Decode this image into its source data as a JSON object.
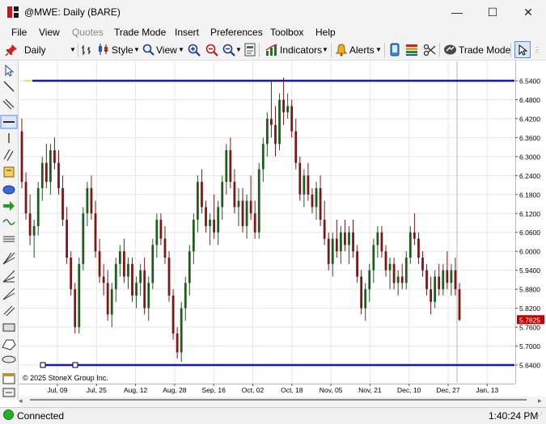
{
  "window": {
    "title": "@MWE: Daily (BARE)",
    "minimize_glyph": "—",
    "maximize_glyph": "☐",
    "close_glyph": "✕"
  },
  "menu": [
    {
      "label": "File",
      "enabled": true
    },
    {
      "label": "View",
      "enabled": true
    },
    {
      "label": "Quotes",
      "enabled": false
    },
    {
      "label": "Trade Mode",
      "enabled": true
    },
    {
      "label": "Insert",
      "enabled": true
    },
    {
      "label": "Preferences",
      "enabled": true
    },
    {
      "label": "Toolbox",
      "enabled": true
    },
    {
      "label": "Help",
      "enabled": true
    }
  ],
  "toolbar": {
    "interval": "Daily",
    "style_label": "Style",
    "view_label": "View",
    "indicators_label": "Indicators",
    "alerts_label": "Alerts",
    "trade_mode_label": "Trade Mode"
  },
  "chart": {
    "copyright": "© 2025 StoneX Group Inc.",
    "last_price_label": "5.7825",
    "colors": {
      "up": "#1f5b1f",
      "down": "#7a1717",
      "hline": "#1515c8",
      "last_price_bg": "#c00000",
      "grid": "#e6e6e6"
    }
  },
  "chart_data": {
    "type": "candlestick",
    "title": "@MWE: Daily (BARE)",
    "ylim": [
      5.61,
      6.57
    ],
    "y_ticks": [
      "6.5400",
      "6.4800",
      "6.4200",
      "6.3600",
      "6.3000",
      "6.2400",
      "6.1800",
      "6.1200",
      "6.0600",
      "6.0000",
      "5.9400",
      "5.8800",
      "5.8200",
      "5.7600",
      "5.7000",
      "5.6400"
    ],
    "x_ticks": [
      "Jul, 09",
      "Jul, 25",
      "Aug, 12",
      "Aug, 28",
      "Sep, 16",
      "Oct, 02",
      "Oct, 18",
      "Nov, 05",
      "Nov, 21",
      "Dec, 10",
      "Dec, 27",
      "Jan, 13"
    ],
    "last_price": 5.7825,
    "horizontal_lines": [
      6.54,
      5.64
    ],
    "ohlc": [
      [
        6.38,
        6.42,
        6.2,
        6.22
      ],
      [
        6.22,
        6.25,
        6.1,
        6.12
      ],
      [
        6.12,
        6.18,
        6.02,
        6.05
      ],
      [
        6.05,
        6.1,
        5.98,
        6.08
      ],
      [
        6.08,
        6.22,
        6.05,
        6.2
      ],
      [
        6.2,
        6.3,
        6.16,
        6.28
      ],
      [
        6.28,
        6.34,
        6.2,
        6.22
      ],
      [
        6.22,
        6.34,
        6.18,
        6.32
      ],
      [
        6.32,
        6.36,
        6.26,
        6.28
      ],
      [
        6.28,
        6.32,
        6.18,
        6.2
      ],
      [
        6.2,
        6.24,
        6.08,
        6.1
      ],
      [
        6.1,
        6.14,
        5.96,
        5.98
      ],
      [
        5.98,
        6.0,
        5.86,
        5.88
      ],
      [
        5.88,
        5.9,
        5.74,
        5.76
      ],
      [
        5.76,
        5.98,
        5.74,
        5.96
      ],
      [
        5.96,
        6.14,
        5.94,
        6.12
      ],
      [
        6.12,
        6.22,
        6.08,
        6.2
      ],
      [
        6.2,
        6.24,
        6.1,
        6.12
      ],
      [
        6.12,
        6.16,
        5.98,
        6.0
      ],
      [
        6.0,
        6.04,
        5.9,
        5.92
      ],
      [
        5.92,
        5.96,
        5.86,
        5.9
      ],
      [
        5.9,
        5.94,
        5.78,
        5.8
      ],
      [
        5.8,
        5.9,
        5.76,
        5.88
      ],
      [
        5.88,
        5.98,
        5.84,
        5.96
      ],
      [
        5.96,
        6.02,
        5.92,
        6.0
      ],
      [
        6.0,
        6.04,
        5.9,
        5.92
      ],
      [
        5.92,
        5.98,
        5.88,
        5.96
      ],
      [
        5.96,
        5.98,
        5.84,
        5.86
      ],
      [
        5.86,
        5.92,
        5.82,
        5.9
      ],
      [
        5.9,
        5.96,
        5.86,
        5.94
      ],
      [
        5.94,
        5.98,
        5.8,
        5.82
      ],
      [
        5.82,
        5.92,
        5.78,
        5.9
      ],
      [
        5.9,
        6.04,
        5.88,
        6.02
      ],
      [
        6.02,
        6.12,
        5.98,
        6.1
      ],
      [
        6.1,
        6.12,
        6.02,
        6.04
      ],
      [
        6.04,
        6.08,
        5.96,
        5.98
      ],
      [
        5.98,
        6.0,
        5.84,
        5.86
      ],
      [
        5.86,
        5.88,
        5.72,
        5.74
      ],
      [
        5.74,
        5.76,
        5.66,
        5.68
      ],
      [
        5.68,
        5.84,
        5.65,
        5.82
      ],
      [
        5.82,
        5.92,
        5.78,
        5.9
      ],
      [
        5.9,
        6.02,
        5.86,
        6.0
      ],
      [
        6.0,
        6.12,
        5.96,
        6.1
      ],
      [
        6.1,
        6.24,
        6.06,
        6.22
      ],
      [
        6.22,
        6.26,
        6.12,
        6.14
      ],
      [
        6.14,
        6.16,
        6.06,
        6.08
      ],
      [
        6.08,
        6.12,
        6.02,
        6.1
      ],
      [
        6.1,
        6.18,
        6.04,
        6.06
      ],
      [
        6.06,
        6.16,
        6.02,
        6.14
      ],
      [
        6.14,
        6.24,
        6.1,
        6.22
      ],
      [
        6.22,
        6.34,
        6.18,
        6.32
      ],
      [
        6.32,
        6.36,
        6.2,
        6.22
      ],
      [
        6.22,
        6.26,
        6.12,
        6.14
      ],
      [
        6.14,
        6.2,
        6.08,
        6.16
      ],
      [
        6.16,
        6.2,
        6.06,
        6.08
      ],
      [
        6.08,
        6.18,
        6.04,
        6.16
      ],
      [
        6.16,
        6.24,
        6.1,
        6.12
      ],
      [
        6.12,
        6.16,
        6.04,
        6.06
      ],
      [
        6.06,
        6.28,
        6.04,
        6.26
      ],
      [
        6.26,
        6.36,
        6.22,
        6.34
      ],
      [
        6.34,
        6.44,
        6.3,
        6.42
      ],
      [
        6.42,
        6.54,
        6.36,
        6.4
      ],
      [
        6.4,
        6.46,
        6.3,
        6.34
      ],
      [
        6.34,
        6.5,
        6.32,
        6.48
      ],
      [
        6.48,
        6.55,
        6.4,
        6.44
      ],
      [
        6.44,
        6.5,
        6.42,
        6.46
      ],
      [
        6.46,
        6.48,
        6.36,
        6.38
      ],
      [
        6.38,
        6.42,
        6.26,
        6.28
      ],
      [
        6.28,
        6.3,
        6.16,
        6.18
      ],
      [
        6.18,
        6.26,
        6.14,
        6.24
      ],
      [
        6.24,
        6.28,
        6.16,
        6.18
      ],
      [
        6.18,
        6.2,
        6.12,
        6.14
      ],
      [
        6.14,
        6.22,
        6.1,
        6.2
      ],
      [
        6.2,
        6.24,
        6.08,
        6.1
      ],
      [
        6.1,
        6.16,
        6.02,
        6.04
      ],
      [
        6.04,
        6.06,
        5.94,
        5.96
      ],
      [
        5.96,
        6.06,
        5.92,
        6.04
      ],
      [
        6.04,
        6.1,
        5.98,
        6.0
      ],
      [
        6.0,
        6.08,
        5.96,
        6.06
      ],
      [
        6.06,
        6.1,
        6.0,
        6.02
      ],
      [
        6.02,
        6.08,
        5.96,
        6.06
      ],
      [
        6.06,
        6.1,
        5.98,
        6.0
      ],
      [
        6.0,
        6.02,
        5.9,
        5.92
      ],
      [
        5.92,
        5.94,
        5.8,
        5.82
      ],
      [
        5.82,
        5.9,
        5.78,
        5.88
      ],
      [
        5.88,
        5.96,
        5.84,
        5.94
      ],
      [
        5.94,
        6.04,
        5.9,
        6.02
      ],
      [
        6.02,
        6.08,
        5.98,
        6.06
      ],
      [
        6.06,
        6.08,
        5.98,
        6.0
      ],
      [
        6.0,
        6.02,
        5.92,
        5.94
      ],
      [
        5.94,
        5.98,
        5.88,
        5.96
      ],
      [
        5.96,
        5.98,
        5.88,
        5.9
      ],
      [
        5.9,
        5.94,
        5.86,
        5.92
      ],
      [
        5.92,
        5.96,
        5.88,
        5.9
      ],
      [
        5.9,
        6.0,
        5.88,
        5.98
      ],
      [
        5.98,
        6.08,
        5.96,
        6.06
      ],
      [
        6.06,
        6.12,
        6.02,
        6.04
      ],
      [
        6.04,
        6.06,
        5.96,
        5.98
      ],
      [
        5.98,
        6.0,
        5.92,
        5.94
      ],
      [
        5.94,
        5.96,
        5.86,
        5.88
      ],
      [
        5.88,
        5.92,
        5.8,
        5.84
      ],
      [
        5.84,
        5.94,
        5.82,
        5.92
      ],
      [
        5.92,
        5.96,
        5.86,
        5.88
      ],
      [
        5.88,
        5.96,
        5.86,
        5.94
      ],
      [
        5.94,
        6.0,
        5.88,
        5.9
      ],
      [
        5.9,
        5.96,
        5.86,
        5.94
      ],
      [
        5.94,
        5.98,
        5.86,
        5.88
      ],
      [
        5.88,
        5.9,
        5.78,
        5.7825
      ]
    ]
  }
}
